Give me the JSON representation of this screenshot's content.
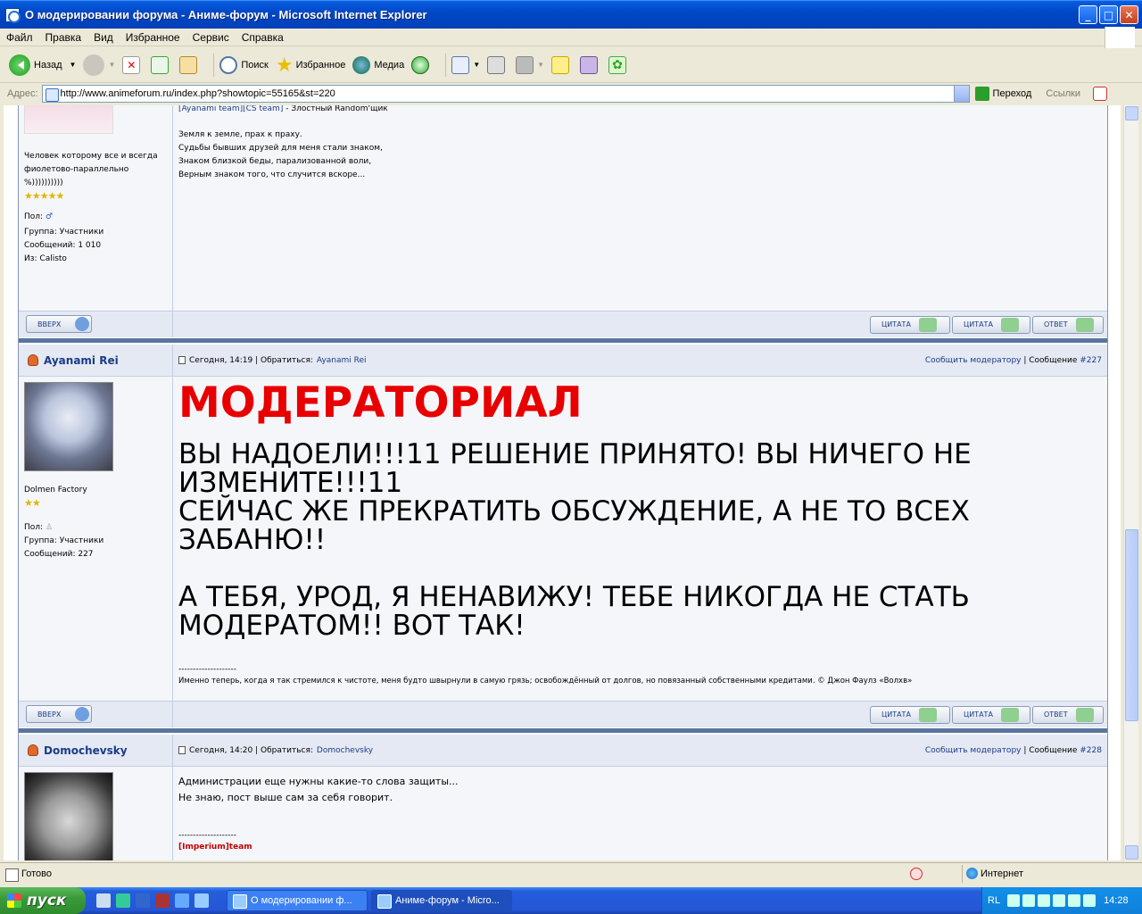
{
  "window": {
    "title": "О модерировании форума - Аниме-форум - Microsoft Internet Explorer"
  },
  "menu": [
    "Файл",
    "Правка",
    "Вид",
    "Избранное",
    "Сервис",
    "Справка"
  ],
  "toolbar": {
    "back": "Назад",
    "search": "Поиск",
    "favorites": "Избранное",
    "media": "Медиа"
  },
  "address": {
    "label": "Адрес:",
    "url": "http://www.animeforum.ru/index.php?showtopic=55165&st=220",
    "go": "Переход",
    "links": "Ссылки"
  },
  "post_prev": {
    "user_title": "Человек которому все и всегда фиолетово-параллельно %))))))))))",
    "stars": "★★★★★",
    "gender_label": "Пол:",
    "group": "Группа: Участники",
    "posts": "Сообщений: 1 010",
    "from": "Из: Calisto",
    "sig_team1": "[Ayanami team]",
    "sig_team2": "[CS team]",
    "sig_team_rest": " - Злостный Random'щик",
    "sig_lines": [
      "Земля к земле, прах к праху.",
      "Судьбы бывших друзей для меня стали знаком,",
      "Знаком близкой беды, парализованной воли,",
      "Верным знаком того, что случится вскоре..."
    ]
  },
  "buttons": {
    "top": "ВВЕРХ",
    "quote": "ЦИТАТА",
    "reply": "ОТВЕТ"
  },
  "post_227": {
    "author": "Ayanami Rei",
    "date": "Сегодня, 14:19",
    "address_label": "Обратиться:",
    "address_name": "Ayanami Rei",
    "report": "Сообщить модератору",
    "msg_label": "Сообщение",
    "msg_num": "#227",
    "user_title": "Dolmen Factory",
    "stars": "★★",
    "gender_label": "Пол:",
    "group": "Группа: Участники",
    "posts": "Сообщений: 227",
    "heading": "МОДЕРАТОРИАЛ",
    "body_lines": [
      "ВЫ НАДОЕЛИ!!!11 РЕШЕНИЕ ПРИНЯТО! ВЫ НИЧЕГО НЕ",
      "ИЗМЕНИТЕ!!!11",
      "СЕЙЧАС ЖЕ ПРЕКРАТИТЬ ОБСУЖДЕНИЕ, А НЕ ТО ВСЕХ",
      "ЗАБАНЮ!!",
      "",
      "А ТЕБЯ, УРОД, Я НЕНАВИЖУ! ТЕБЕ НИКОГДА НЕ СТАТЬ",
      "МОДЕРАТОМ!! ВОТ ТАК!"
    ],
    "sig_sep": "--------------------",
    "sig": "Именно теперь, когда я так стремился к чистоте, меня будто швырнули в самую грязь; освобождённый от долгов, но повязанный собственными кредитами. © Джон Фаулз «Волхв»"
  },
  "post_228": {
    "author": "Domochevsky",
    "date": "Сегодня, 14:20",
    "address_label": "Обратиться:",
    "address_name": "Domochevsky",
    "report": "Сообщить модератору",
    "msg_label": "Сообщение",
    "msg_num": "#228",
    "body_lines": [
      "Администрации еще нужны какие-то слова защиты...",
      "Не знаю, пост выше сам за себя говорит."
    ],
    "sig_sep": "--------------------",
    "sig": "[Imperium]team"
  },
  "status": {
    "text": "Готово",
    "zone": "Интернет"
  },
  "taskbar": {
    "start": "пуск",
    "tasks": [
      "О модерировании ф...",
      "Аниме-форум - Micro..."
    ],
    "lang": "RL",
    "clock": "14:28"
  }
}
